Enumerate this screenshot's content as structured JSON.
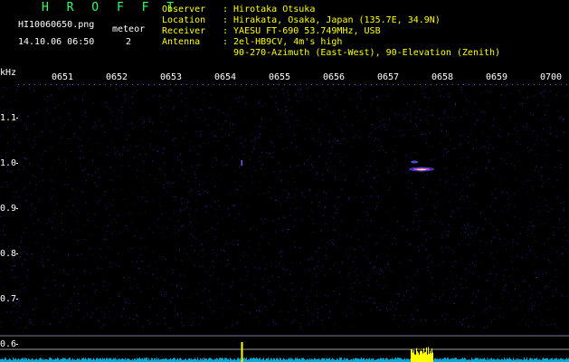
{
  "header": {
    "brand": "H R O F F T",
    "filename": "HI10060650.png",
    "datetime": "14.10.06 06:50",
    "meteor_label": "meteor",
    "meteor_count": "2"
  },
  "info": [
    {
      "key": "Observer",
      "value": ": Hirotaka Otsuka"
    },
    {
      "key": "Location",
      "value": ": Hirakata, Osaka, Japan (135.7E, 34.9N)"
    },
    {
      "key": "Receiver",
      "value": ": YAESU FT-690 53.749MHz, USB"
    },
    {
      "key": "Antenna",
      "value": ": 2el-HB9CV, 4m's high"
    },
    {
      "key": "",
      "value": "  90-270-Azimuth (East-West), 90-Elevation (Zenith)"
    }
  ],
  "colors": {
    "background": "#000000",
    "text_green": "#33ff66",
    "text_white": "#ffffff",
    "text_yellow": "#ffff00",
    "noise_blue": "#3a3ad8",
    "baseline_cyan": "#00c8ff",
    "echo_yellow": "#ffff00"
  },
  "chart_data": {
    "type": "heatmap",
    "ylabel": "kHz",
    "x_ticks": [
      "0651",
      "0652",
      "0653",
      "0654",
      "0655",
      "0656",
      "0657",
      "0658",
      "0659",
      "0700"
    ],
    "y_ticks": [
      "1.1",
      "1.0",
      "0.9",
      "0.8",
      "0.7",
      "0.6"
    ],
    "ylim": [
      0.58,
      1.19
    ],
    "xlim": [
      0,
      10
    ],
    "events": [
      {
        "x": 4.3,
        "freq": 1.0,
        "intensity": 0.6
      },
      {
        "x": 7.45,
        "freq": 0.99,
        "intensity": 1.0
      }
    ],
    "baseline_spikes": [
      {
        "x": 4.3,
        "amplitude": 1.0
      },
      {
        "x": 7.45,
        "amplitude": 0.85
      }
    ]
  }
}
